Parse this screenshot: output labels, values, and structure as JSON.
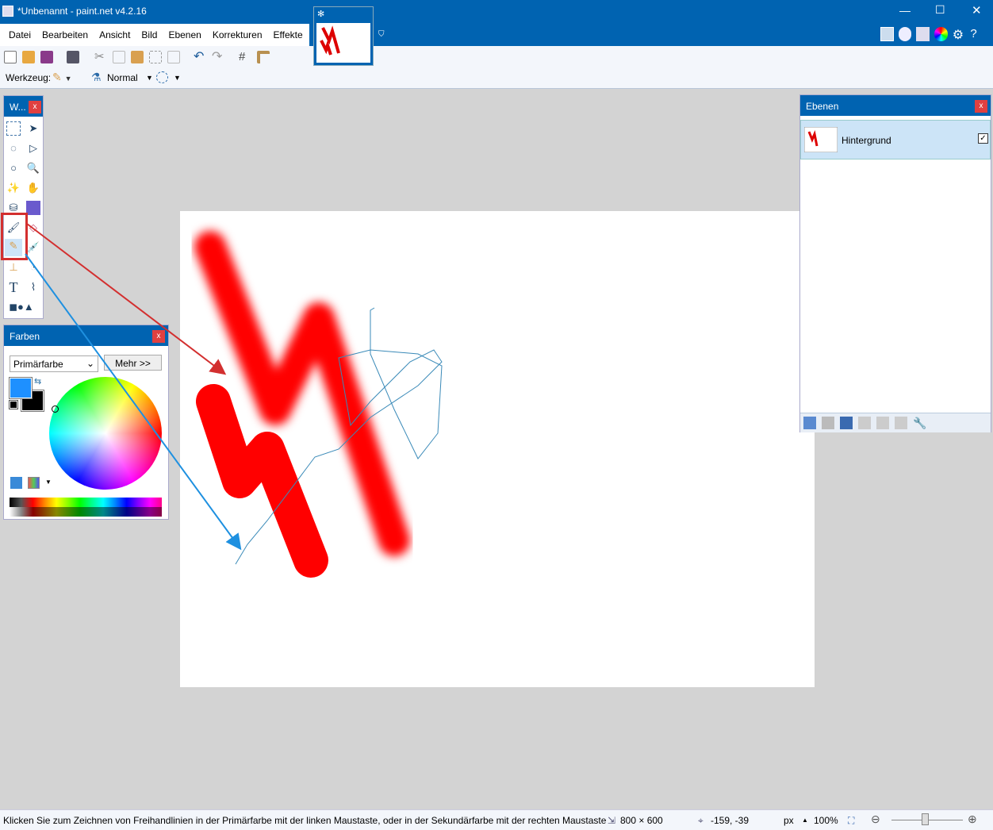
{
  "title": "*Unbenannt - paint.net v4.2.16",
  "menu": [
    "Datei",
    "Bearbeiten",
    "Ansicht",
    "Bild",
    "Ebenen",
    "Korrekturen",
    "Effekte"
  ],
  "toolbar": {
    "tool_label": "Werkzeug:",
    "blend_mode": "Normal"
  },
  "tools_panel": {
    "title": "W...",
    "close": "x"
  },
  "colors_panel": {
    "title": "Farben",
    "close": "x",
    "select": "Primärfarbe",
    "more_button": "Mehr >>",
    "primary_color": "#1e90ff",
    "secondary_color": "#000000"
  },
  "layers_panel": {
    "title": "Ebenen",
    "close": "x",
    "layers": [
      {
        "name": "Hintergrund",
        "visible": true
      }
    ]
  },
  "status": {
    "hint": "Klicken Sie zum Zeichnen von Freihandlinien in der Primärfarbe mit der linken Maustaste, oder in der Sekundärfarbe mit der rechten Maustaste",
    "size": "800 × 600",
    "cursor": "-159, -39",
    "unit": "px",
    "zoom": "100%"
  },
  "colors": {
    "accent": "#0063b1",
    "highlight": "#d32f2f",
    "arrow_blue": "#1e90e0"
  }
}
